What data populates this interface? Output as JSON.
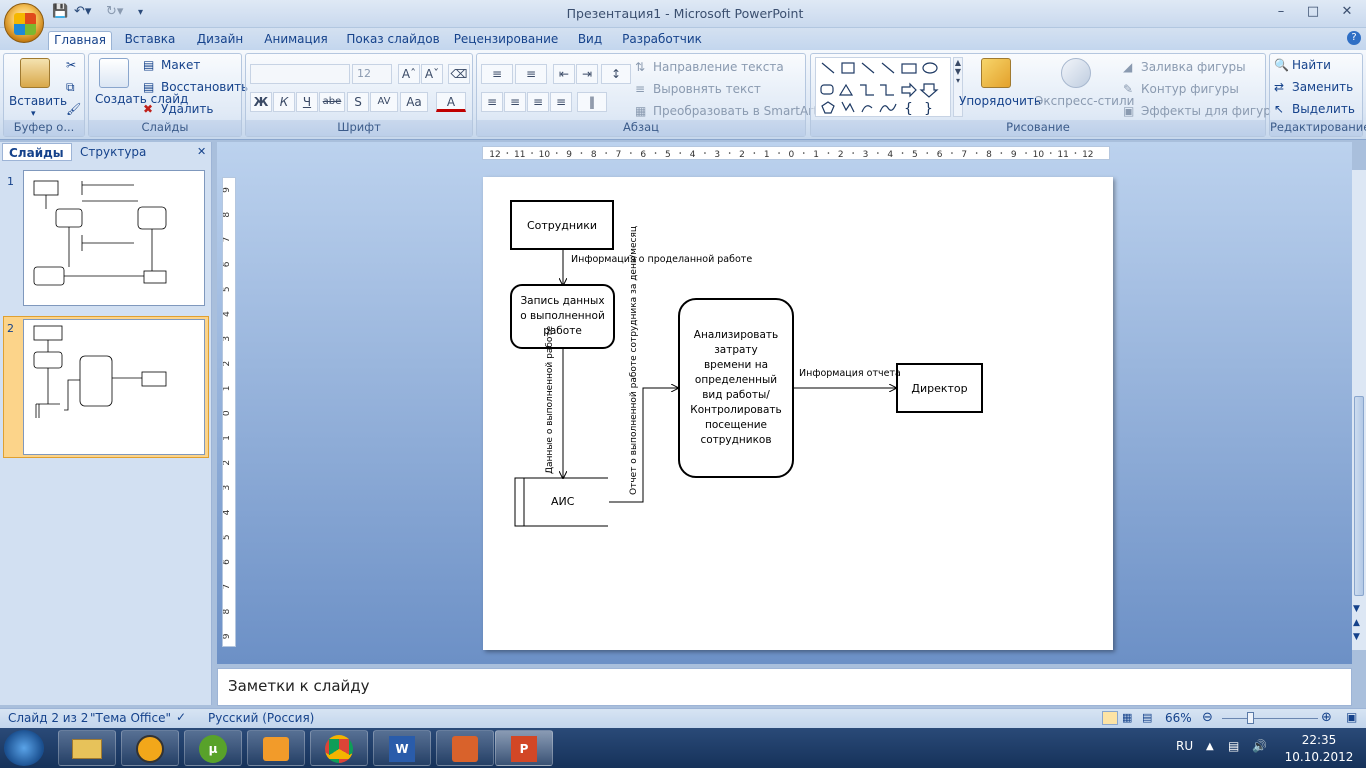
{
  "window": {
    "title": "Презентация1 - Microsoft PowerPoint"
  },
  "tabs": [
    "Главная",
    "Вставка",
    "Дизайн",
    "Анимация",
    "Показ слайдов",
    "Рецензирование",
    "Вид",
    "Разработчик"
  ],
  "ribbon": {
    "clipboard": {
      "paste": "Вставить",
      "label": "Буфер о..."
    },
    "slides": {
      "new_slide": "Создать слайд",
      "layout": "Макет",
      "reset": "Восстановить",
      "delete": "Удалить",
      "label": "Слайды"
    },
    "font": {
      "size": "12",
      "label": "Шрифт",
      "bold": "Ж",
      "italic": "К",
      "underline": "Ч",
      "strike": "abe",
      "shadow": "S",
      "spacing": "AV",
      "case": "Aa",
      "color": "A"
    },
    "paragraph": {
      "text_dir": "Направление текста",
      "align_text": "Выровнять текст",
      "smartart": "Преобразовать в SmartArt",
      "label": "Абзац"
    },
    "drawing": {
      "arrange": "Упорядочить",
      "quick_styles": "Экспресс-стили",
      "fill": "Заливка фигуры",
      "outline": "Контур фигуры",
      "effects": "Эффекты для фигур",
      "label": "Рисование"
    },
    "editing": {
      "find": "Найти",
      "replace": "Заменить",
      "select": "Выделить",
      "label": "Редактирование"
    }
  },
  "panel": {
    "tab_slides": "Слайды",
    "tab_outline": "Структура",
    "slide_numbers": [
      "1",
      "2"
    ]
  },
  "ruler_labels": [
    "12",
    "11",
    "10",
    "9",
    "8",
    "7",
    "6",
    "5",
    "4",
    "3",
    "2",
    "1",
    "0",
    "1",
    "2",
    "3",
    "4",
    "5",
    "6",
    "7",
    "8",
    "9",
    "10",
    "11",
    "12"
  ],
  "slide": {
    "employees": "Сотрудники",
    "info_done": "Информация о проделанной работе",
    "record": "Запись данных о выполненной работе",
    "data_done": "Данные о выполненной работе",
    "report_vertical": "Отчет о выполненной работе сотрудника за день/месяц",
    "analyze": "Анализировать затрату времени на определенный вид работы/ Контролировать посещение сотрудников",
    "report_info": "Информация отчета",
    "director": "Директор",
    "ais": "АИС"
  },
  "notes": {
    "placeholder": "Заметки к слайду"
  },
  "status": {
    "slide": "Слайд 2 из 2",
    "theme": "\"Тема Office\"",
    "lang": "Русский (Россия)",
    "zoom": "66%"
  },
  "taskbar": {
    "lang": "RU",
    "time": "22:35",
    "date": "10.10.2012"
  }
}
